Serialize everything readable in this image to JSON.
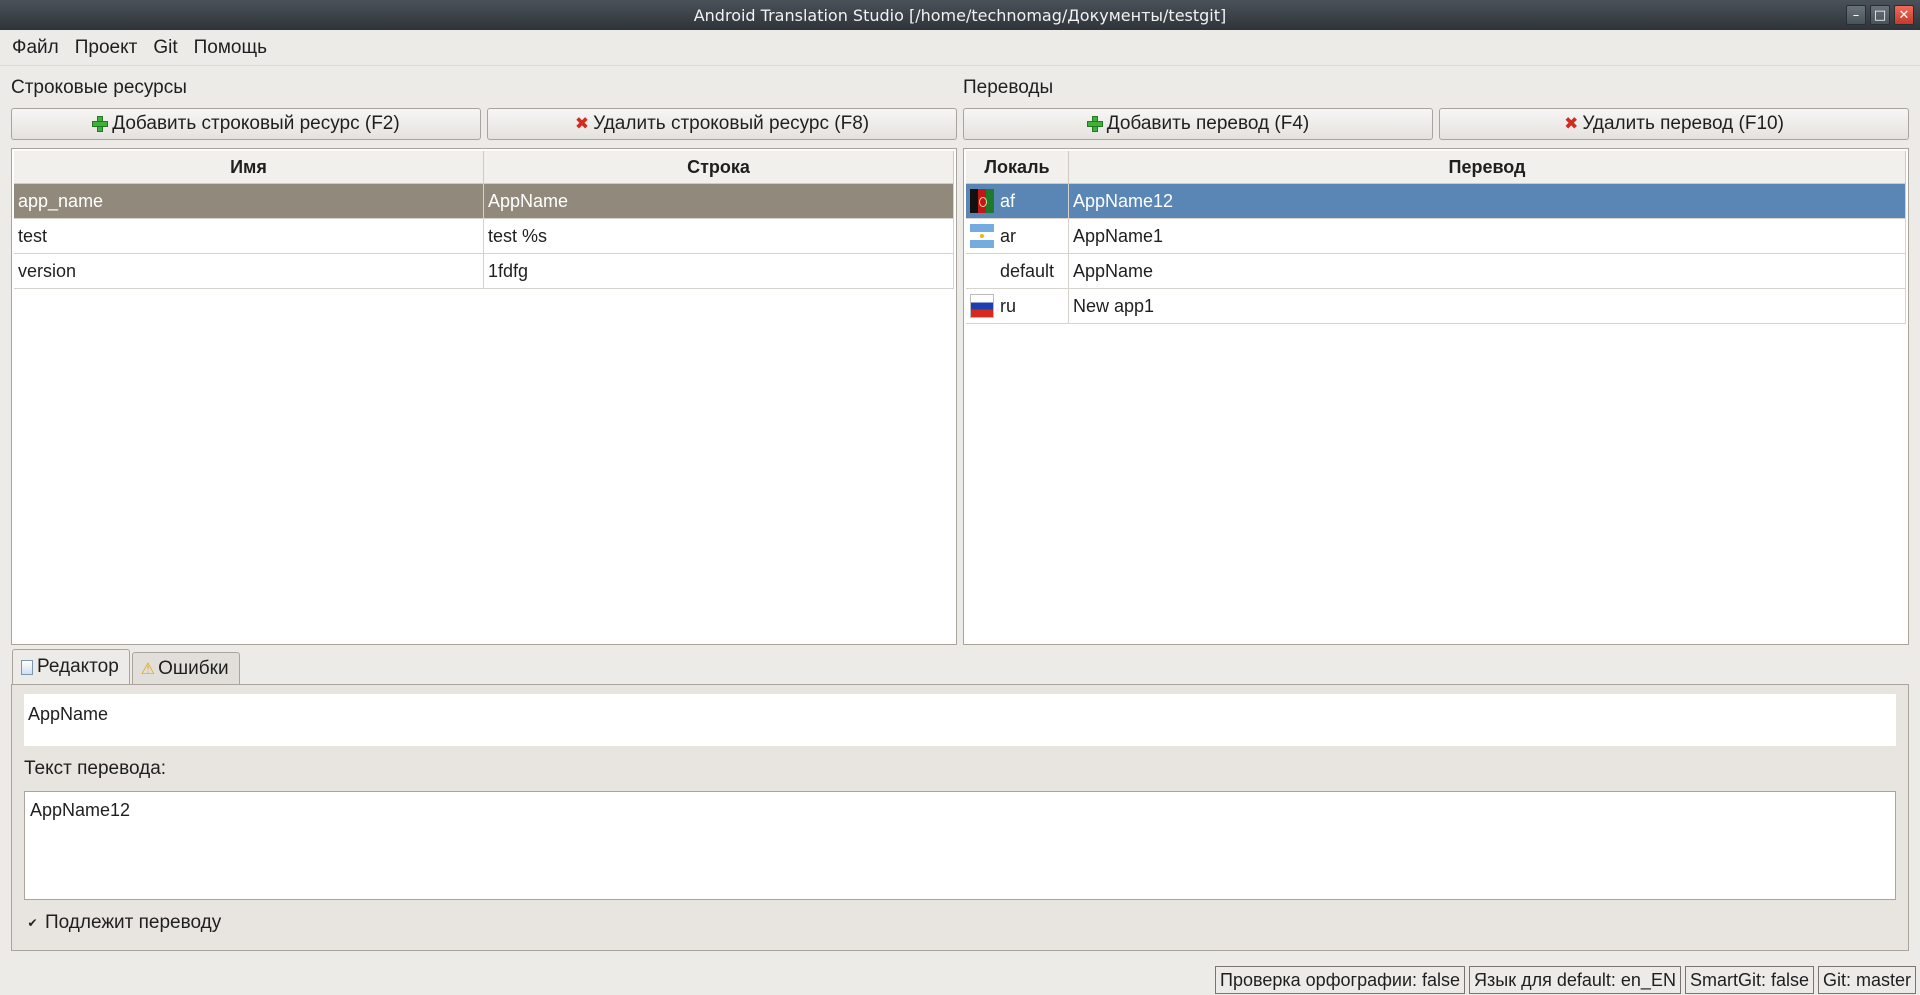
{
  "window": {
    "title": "Android Translation Studio [/home/technomag/Документы/testgit]",
    "minimize_icon": "minimize-icon",
    "maximize_icon": "maximize-icon",
    "close_icon": "close-icon"
  },
  "menu": [
    "Файл",
    "Проект",
    "Git",
    "Помощь"
  ],
  "left": {
    "label": "Строковые ресурсы",
    "add_button": "Добавить строковый ресурс (F2)",
    "delete_button": "Удалить строковый ресурс (F8)",
    "columns": [
      "Имя",
      "Строка"
    ],
    "rows": [
      {
        "name": "app_name",
        "value": "AppName"
      },
      {
        "name": "test",
        "value": "test %s"
      },
      {
        "name": "version",
        "value": "1fdfg"
      }
    ]
  },
  "right": {
    "label": "Переводы",
    "add_button": "Добавить перевод (F4)",
    "delete_button": "Удалить перевод (F10)",
    "columns": [
      "Локаль",
      "Перевод"
    ],
    "rows": [
      {
        "locale": "af",
        "flag": "afghanistan-flag",
        "translation": "AppName12"
      },
      {
        "locale": "ar",
        "flag": "argentina-flag",
        "translation": "AppName1"
      },
      {
        "locale": "default",
        "flag": "",
        "translation": "AppName"
      },
      {
        "locale": "ru",
        "flag": "russia-flag",
        "translation": "New app1"
      }
    ]
  },
  "tabs": [
    {
      "label": "Редактор",
      "icon": "document-icon"
    },
    {
      "label": "Ошибки",
      "icon": "warning-icon"
    }
  ],
  "editor": {
    "source_text": "AppName",
    "translation_label": "Текст перевода:",
    "translation_text": "AppName12",
    "translatable_label": "Подлежит переводу",
    "translatable_checked": true
  },
  "status": [
    "Проверка орфографии: false",
    "Язык для default: en_EN",
    "SmartGit: false",
    "Git: master"
  ],
  "colors": {
    "left_selection": "#918a7c",
    "right_selection": "#5a86b5",
    "add_icon": "#3fb13a",
    "delete_icon": "#d42a1f"
  }
}
